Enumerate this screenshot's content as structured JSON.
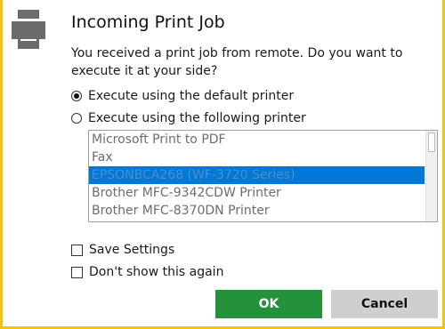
{
  "dialog": {
    "title": "Incoming Print Job",
    "message": "You received a print job from remote. Do you want to execute it at your side?",
    "accent_color": "#f5c30a",
    "icon": "printer-icon"
  },
  "options": {
    "default_printer_label": "Execute using the default printer",
    "following_printer_label": "Execute using the following printer",
    "selected": "default"
  },
  "printers": {
    "items": [
      "Microsoft Print to PDF",
      "Fax",
      "EPSONBCA268 (WF-3720 Series)",
      "Brother MFC-9342CDW Printer",
      "Brother MFC-8370DN Printer"
    ],
    "selected_index": 2
  },
  "checkboxes": {
    "save_settings_label": "Save Settings",
    "dont_show_label": "Don't show this again"
  },
  "buttons": {
    "ok_label": "OK",
    "cancel_label": "Cancel",
    "ok_color": "#23923a",
    "cancel_color": "#cfcfcf"
  }
}
